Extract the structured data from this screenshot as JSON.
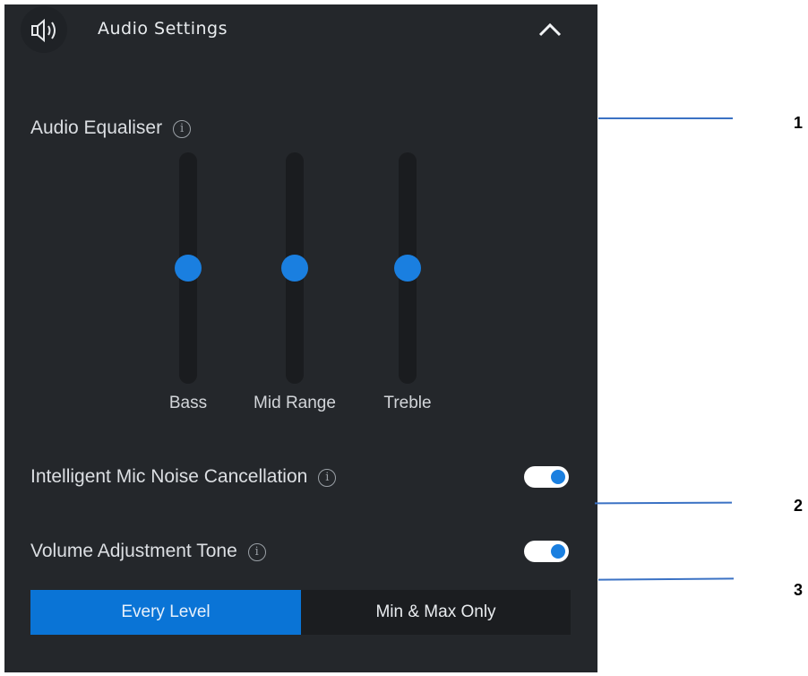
{
  "header": {
    "title": "Audio Settings",
    "speaker_icon": "speaker-icon",
    "collapse_icon": "chevron-up-icon"
  },
  "equaliser": {
    "label": "Audio Equaliser",
    "info_icon": "i",
    "sliders": [
      {
        "label": "Bass",
        "level": 0.5
      },
      {
        "label": "Mid Range",
        "level": 0.5
      },
      {
        "label": "Treble",
        "level": 0.5
      }
    ]
  },
  "noise_cancellation": {
    "label": "Intelligent Mic Noise Cancellation",
    "info_icon": "i",
    "enabled": true
  },
  "volume_tone": {
    "label": "Volume Adjustment Tone",
    "info_icon": "i",
    "enabled": true,
    "options": [
      "Every Level",
      "Min & Max Only"
    ],
    "selected": "Every Level"
  },
  "callouts": [
    "1",
    "2",
    "3"
  ],
  "colors": {
    "panel_bg": "#24272b",
    "accent": "#0a74d6",
    "thumb": "#1a7fe0",
    "callout_line": "#3b72c4"
  }
}
